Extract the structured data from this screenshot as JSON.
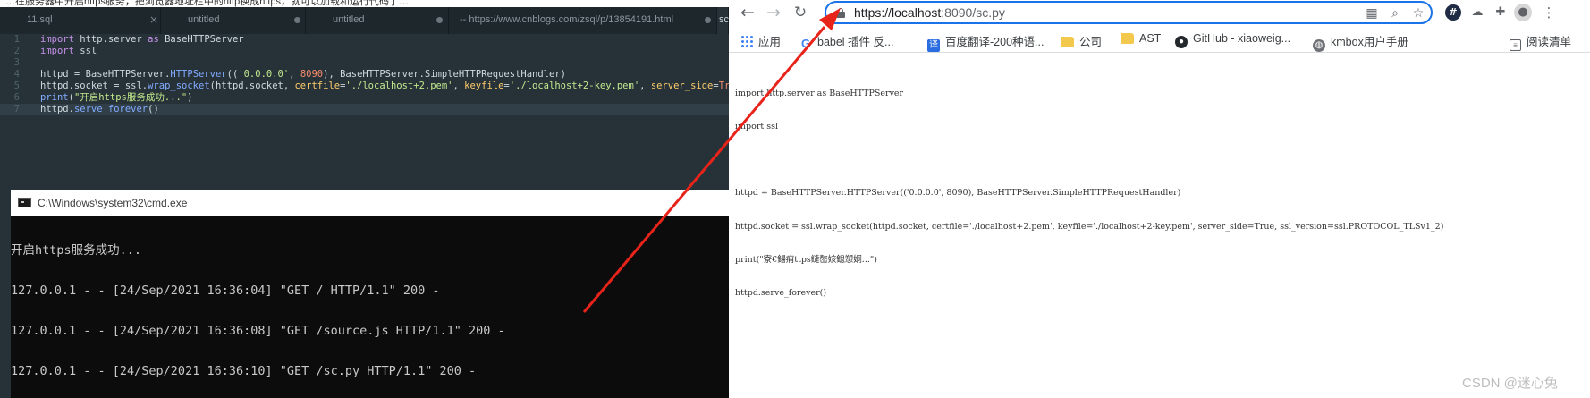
{
  "editor": {
    "top_strip_text": "…在服务器中开启https服务，把浏览器地址栏中的http换成https，就可以加载和运行代码了…",
    "tabs": [
      {
        "label": "11.sql",
        "marker": "×"
      },
      {
        "label": "untitled",
        "marker": "•"
      },
      {
        "label": "untitled",
        "marker": "•"
      },
      {
        "label": "-- https://www.cnblogs.com/zsql/p/13854191.html",
        "marker": "•"
      },
      {
        "label": "sc",
        "marker": ""
      }
    ],
    "lines": [
      {
        "num": "1",
        "text": "import http.server as BaseHTTPServer"
      },
      {
        "num": "2",
        "text": "import ssl"
      },
      {
        "num": "3",
        "text": ""
      },
      {
        "num": "4",
        "text": "httpd = BaseHTTPServer.HTTPServer(('0.0.0.0', 8090), BaseHTTPServer.SimpleHTTPRequestHandler)"
      },
      {
        "num": "5",
        "text": "httpd.socket = ssl.wrap_socket(httpd.socket, certfile='./localhost+2.pem', keyfile='./localhost+2-key.pem', server_side=True, s"
      },
      {
        "num": "6",
        "text": "print(\"开启https服务成功...\")"
      },
      {
        "num": "7",
        "text": "httpd.serve_forever()"
      }
    ]
  },
  "cmd": {
    "title": "C:\\Windows\\system32\\cmd.exe",
    "lines": [
      "开启https服务成功...",
      "127.0.0.1 - - [24/Sep/2021 16:36:04] \"GET / HTTP/1.1\" 200 -",
      "127.0.0.1 - - [24/Sep/2021 16:36:08] \"GET /source.js HTTP/1.1\" 200 -",
      "127.0.0.1 - - [24/Sep/2021 16:36:10] \"GET /sc.py HTTP/1.1\" 200 -"
    ]
  },
  "browser": {
    "url_scheme_host": "https://localhost",
    "url_rest": ":8090/sc.py",
    "bookmarks": [
      {
        "label": "应用",
        "icon": "apps-grid-icon"
      },
      {
        "label": "babel 插件 反...",
        "icon": "google-icon"
      },
      {
        "label": "百度翻译-200种语...",
        "icon": "translate-icon"
      },
      {
        "label": "公司",
        "icon": "folder-icon"
      },
      {
        "label": "AST",
        "icon": "folder-icon"
      },
      {
        "label": "GitHub - xiaoweig...",
        "icon": "github-icon"
      },
      {
        "label": "kmbox用户手册",
        "icon": "globe-icon"
      },
      {
        "label": "阅读清单",
        "icon": "reading-list-icon"
      }
    ],
    "page_lines": [
      "import http.server as BaseHTTPServer",
      "import ssl",
      "",
      "httpd = BaseHTTPServer.HTTPServer(('0.0.0.0', 8090), BaseHTTPServer.SimpleHTTPRequestHandler)",
      "httpd.socket = ssl.wrap_socket(httpd.socket, certfile='./localhost+2.pem', keyfile='./localhost+2-key.pem', server_side=True, ssl_version=ssl.PROTOCOL_TLSv1_2)",
      "print(\"寮€鍚痟ttps鏈嶅姟鎴愬姛...\")",
      "httpd.serve_forever()"
    ]
  },
  "watermark": "CSDN @迷心兔",
  "colors": {
    "arrow": "#e8231a",
    "omnibox_focus": "#1a73e8"
  }
}
